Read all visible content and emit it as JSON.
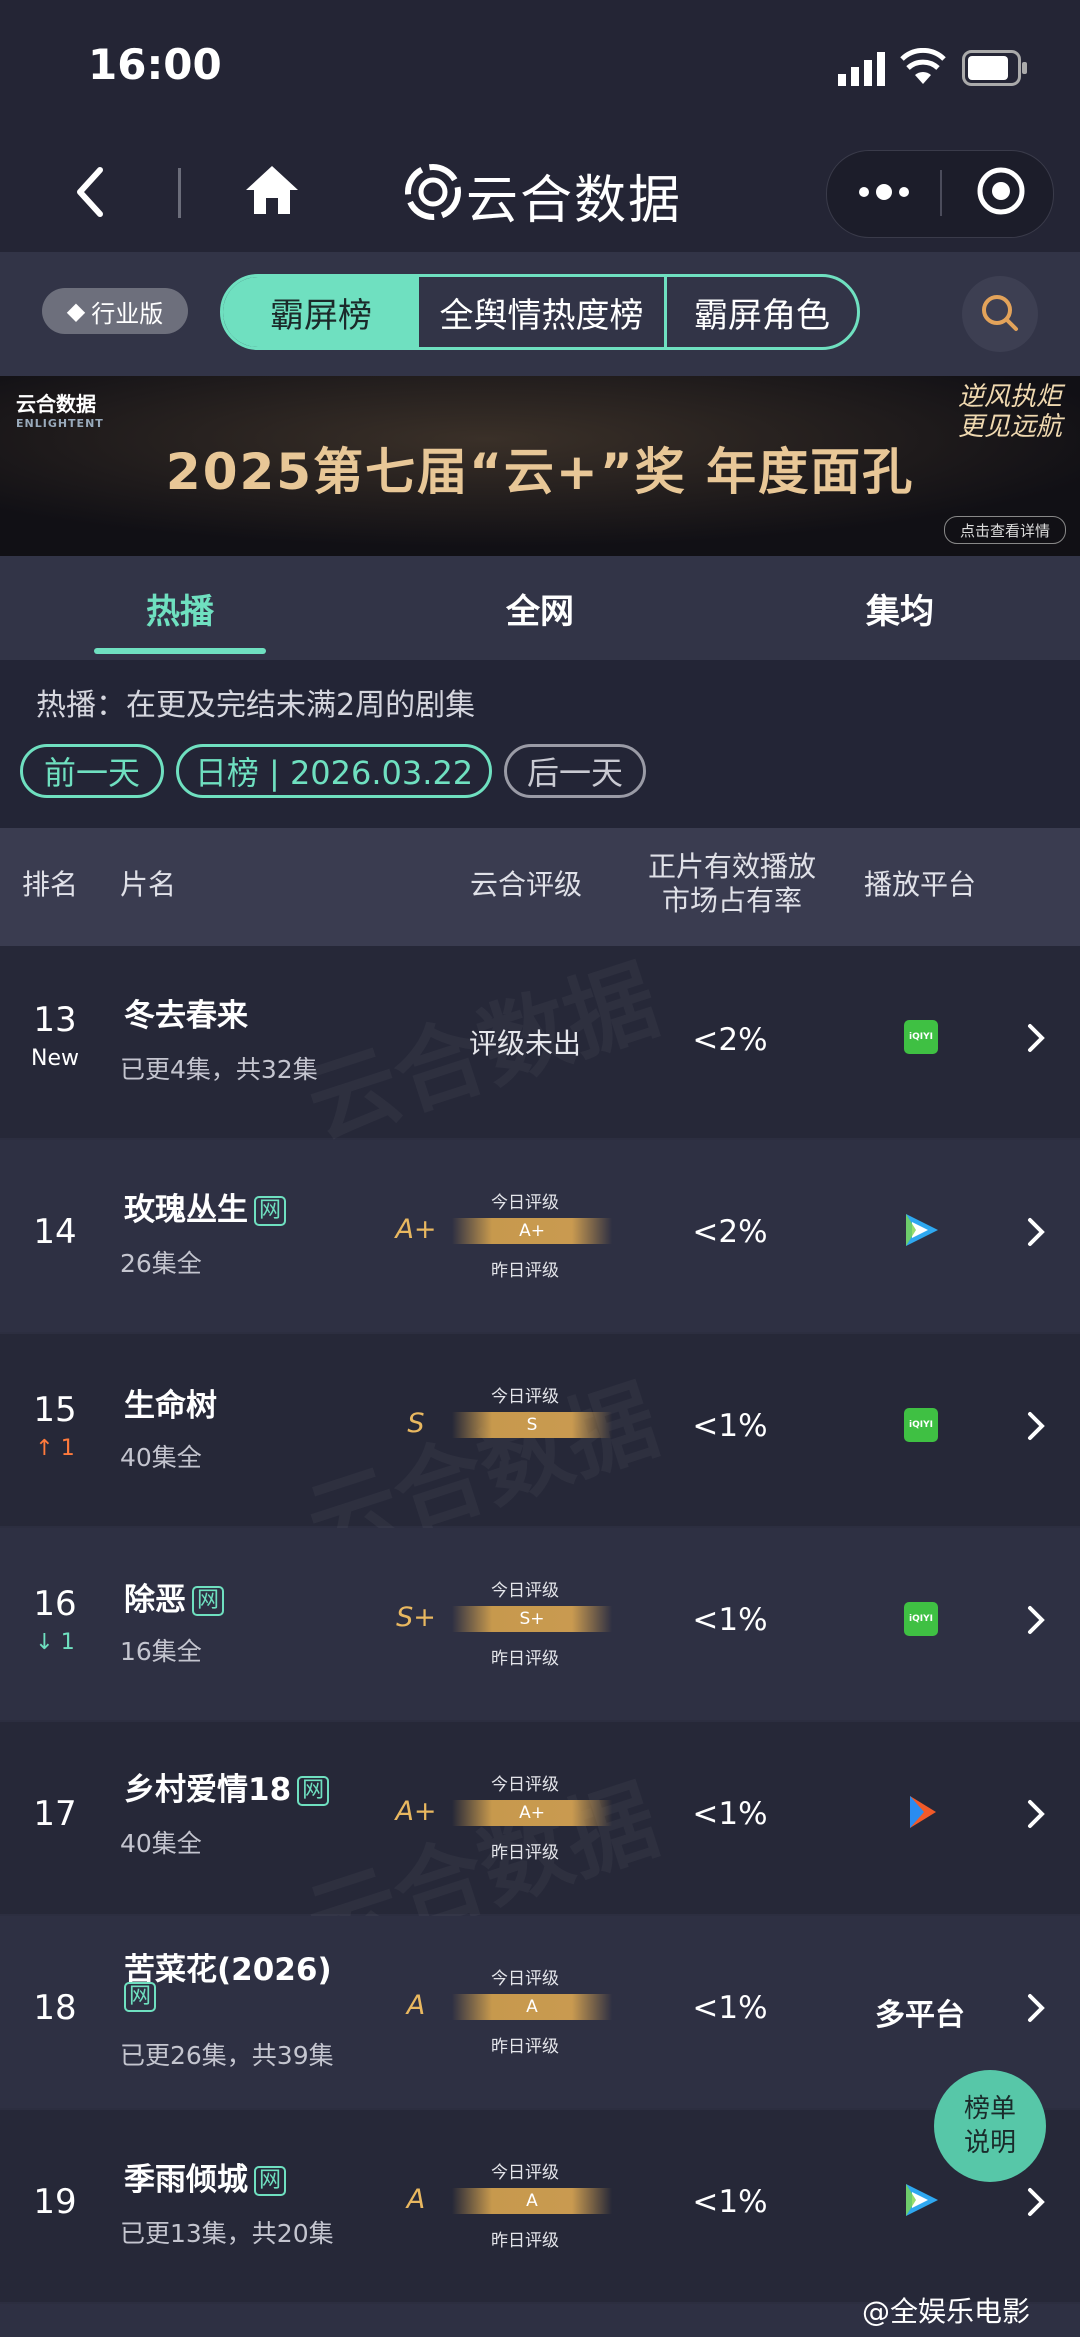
{
  "status": {
    "time": "16:00"
  },
  "nav": {
    "title": "云合数据"
  },
  "top_tabs": {
    "industry_label": "行业版",
    "segments": [
      "霸屏榜",
      "全舆情热度榜",
      "霸屏角色"
    ]
  },
  "banner": {
    "brand": "云合数据",
    "brand_en": "ENLIGHTENT",
    "title": "2025第七届“云+”奖  年度面孔",
    "slogan": "逆风执炬 更见远航",
    "button": "点击查看详情"
  },
  "sub_tabs": [
    "热播",
    "全网",
    "集均"
  ],
  "description": "热播：在更及完结未满2周的剧集",
  "date_nav": {
    "prev": "前一天",
    "current": "日榜 | 2026.03.22",
    "next": "后一天"
  },
  "table": {
    "headers": {
      "rank": "排名",
      "title": "片名",
      "rating": "云合评级",
      "share_line1": "正片有效播放",
      "share_line2": "市场占有率",
      "platform": "播放平台"
    },
    "today_label": "今日评级",
    "yesterday_label": "昨日评级",
    "rows": [
      {
        "rank": "13",
        "change": "New",
        "title": "冬去春来",
        "badge": "",
        "episodes": "已更4集，共32集",
        "rating": "评级未出",
        "grade": "",
        "bar_grade": "",
        "share": "<2%",
        "platform": "iqiyi"
      },
      {
        "rank": "14",
        "change": "",
        "title": "玫瑰丛生",
        "badge": "网",
        "episodes": "26集全",
        "rating": "",
        "grade": "A+",
        "bar_grade": "A+",
        "share": "<2%",
        "platform": "tencent"
      },
      {
        "rank": "15",
        "change": "↑ 1",
        "title": "生命树",
        "badge": "",
        "episodes": "40集全",
        "rating": "",
        "grade": "S",
        "bar_grade": "S",
        "share": "<1%",
        "platform": "iqiyi"
      },
      {
        "rank": "16",
        "change": "↓ 1",
        "title": "除恶",
        "badge": "网",
        "episodes": "16集全",
        "rating": "",
        "grade": "S+",
        "bar_grade": "S+",
        "share": "<1%",
        "platform": "iqiyi"
      },
      {
        "rank": "17",
        "change": "",
        "title": "乡村爱情18",
        "badge": "网",
        "episodes": "40集全",
        "rating": "",
        "grade": "A+",
        "bar_grade": "A+",
        "share": "<1%",
        "platform": "youku"
      },
      {
        "rank": "18",
        "change": "",
        "title": "苦菜花(2026)",
        "badge": "网",
        "episodes": "已更26集，共39集",
        "rating": "",
        "grade": "A",
        "bar_grade": "A",
        "share": "<1%",
        "platform": "多平台"
      },
      {
        "rank": "19",
        "change": "",
        "title": "季雨倾城",
        "badge": "网",
        "episodes": "已更13集，共20集",
        "rating": "",
        "grade": "A",
        "bar_grade": "A",
        "share": "<1%",
        "platform": "tencent"
      }
    ]
  },
  "fab": {
    "line1": "榜单",
    "line2": "说明"
  },
  "weibo": "@全娱乐电影",
  "iqiyi_text": "iQIYI",
  "watermark": "云合数据",
  "colors": {
    "accent": "#6fe0c0",
    "grade": "#e9b860",
    "bg": "#232536"
  }
}
